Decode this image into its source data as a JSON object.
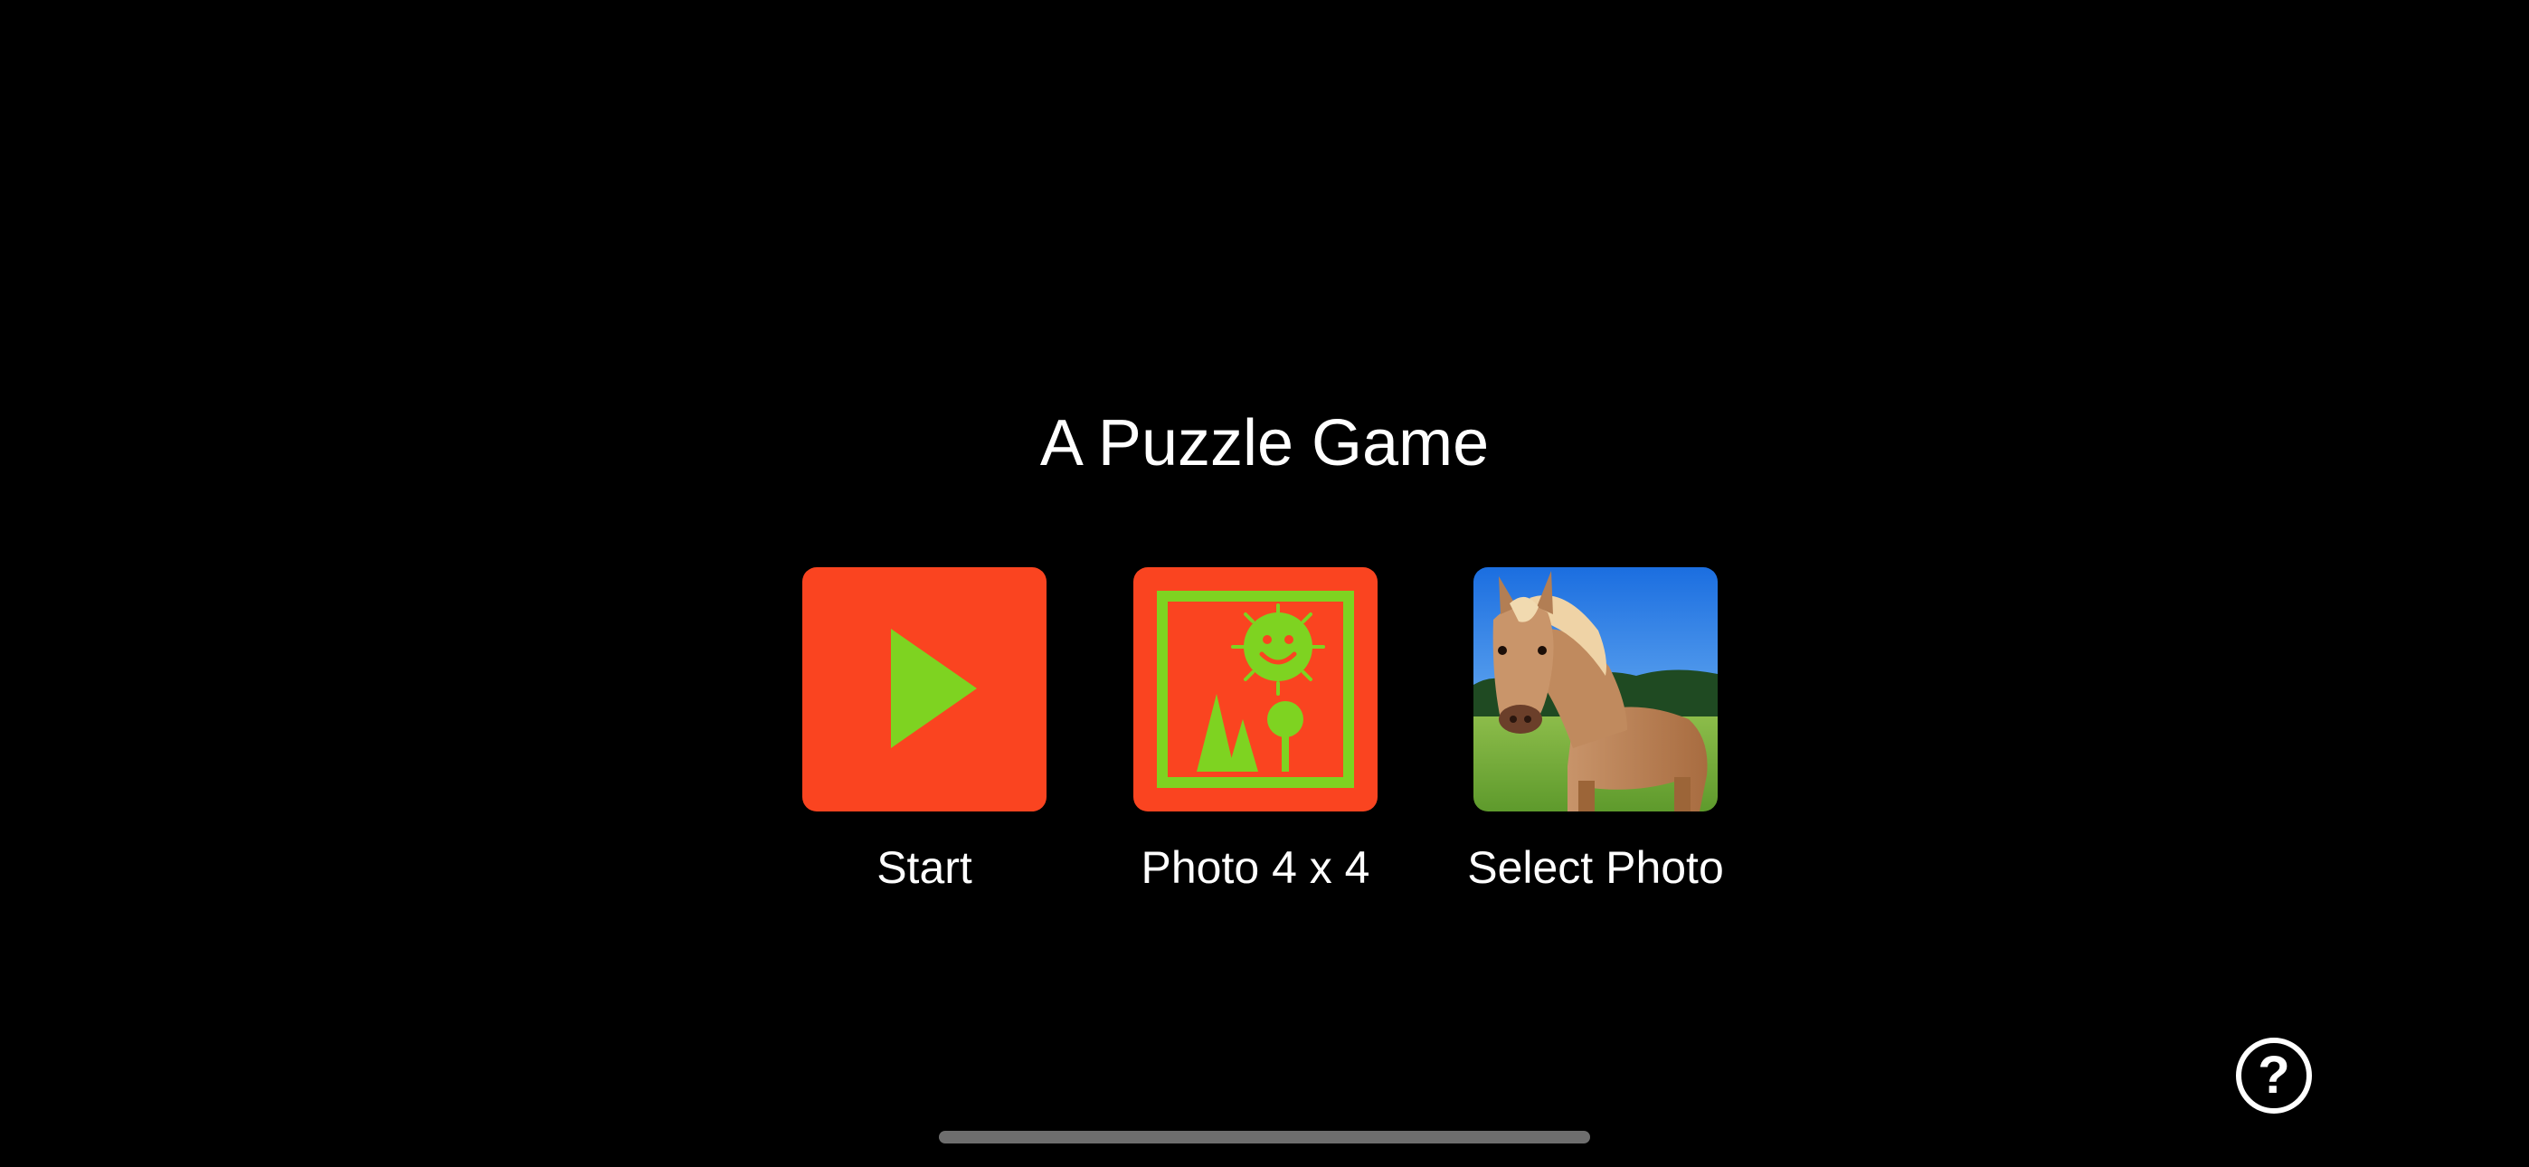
{
  "app": {
    "title": "A Puzzle Game"
  },
  "menu": {
    "items": [
      {
        "label": "Start",
        "icon": "play-icon"
      },
      {
        "label": "Photo 4 x 4",
        "icon": "photo-puzzle-icon"
      },
      {
        "label": "Select Photo",
        "icon": "horse-photo-thumbnail"
      }
    ]
  },
  "help": {
    "label": "?",
    "icon": "question-mark-icon"
  },
  "colors": {
    "background": "#000000",
    "tile_accent": "#fa4420",
    "icon_green": "#7ed321",
    "text": "#ffffff",
    "home_indicator": "#6e6e6e"
  }
}
